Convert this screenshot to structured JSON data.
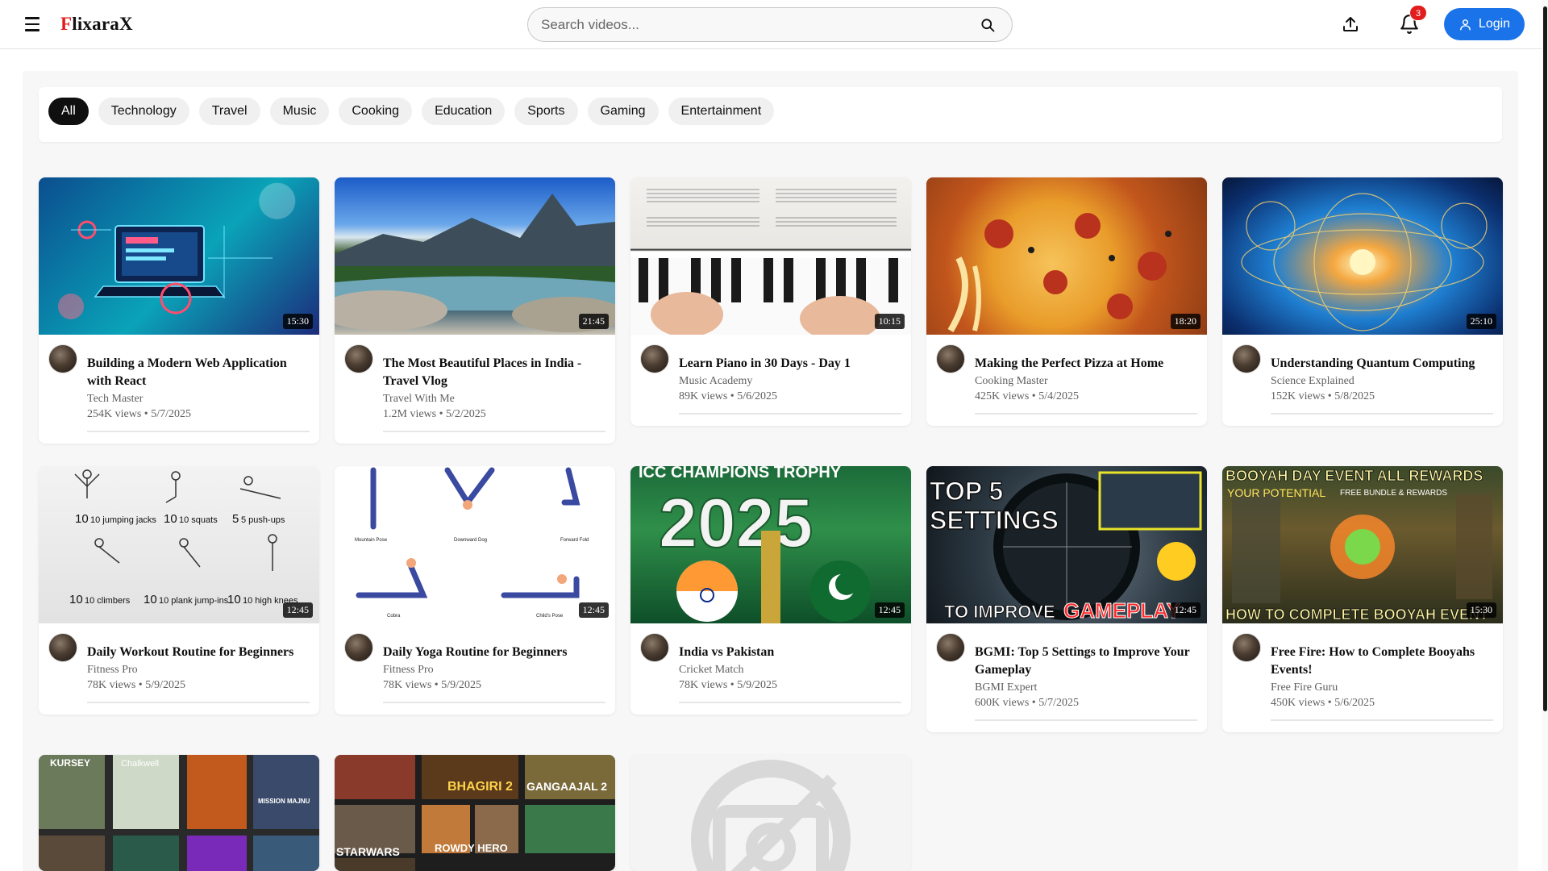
{
  "header": {
    "logo_first": "F",
    "logo_rest": "lixaraX",
    "search_placeholder": "Search videos...",
    "notification_count": "3",
    "login_label": "Login",
    "icons": {
      "menu": "hamburger-menu-icon",
      "search": "search-icon",
      "upload": "upload-icon",
      "bell": "bell-icon",
      "user": "user-icon"
    }
  },
  "categories": [
    {
      "label": "All",
      "active": true
    },
    {
      "label": "Technology",
      "active": false
    },
    {
      "label": "Travel",
      "active": false
    },
    {
      "label": "Music",
      "active": false
    },
    {
      "label": "Cooking",
      "active": false
    },
    {
      "label": "Education",
      "active": false
    },
    {
      "label": "Sports",
      "active": false
    },
    {
      "label": "Gaming",
      "active": false
    },
    {
      "label": "Entertainment",
      "active": false
    }
  ],
  "videos": [
    {
      "title": "Building a Modern Web Application with React",
      "channel": "Tech Master",
      "views": "254K views",
      "date": "5/7/2025",
      "duration": "15:30"
    },
    {
      "title": "The Most Beautiful Places in India - Travel Vlog",
      "channel": "Travel With Me",
      "views": "1.2M views",
      "date": "5/2/2025",
      "duration": "21:45"
    },
    {
      "title": "Learn Piano in 30 Days - Day 1",
      "channel": "Music Academy",
      "views": "89K views",
      "date": "5/6/2025",
      "duration": "10:15"
    },
    {
      "title": "Making the Perfect Pizza at Home",
      "channel": "Cooking Master",
      "views": "425K views",
      "date": "5/4/2025",
      "duration": "18:20"
    },
    {
      "title": "Understanding Quantum Computing",
      "channel": "Science Explained",
      "views": "152K views",
      "date": "5/8/2025",
      "duration": "25:10"
    },
    {
      "title": "Daily Workout Routine for Beginners",
      "channel": "Fitness Pro",
      "views": "78K views",
      "date": "5/9/2025",
      "duration": "12:45"
    },
    {
      "title": "Daily Yoga Routine for Beginners",
      "channel": "Fitness Pro",
      "views": "78K views",
      "date": "5/9/2025",
      "duration": "12:45"
    },
    {
      "title": "India vs Pakistan",
      "channel": "Cricket Match",
      "views": "78K views",
      "date": "5/9/2025",
      "duration": "12:45"
    },
    {
      "title": "BGMI: Top 5 Settings to Improve Your Gameplay",
      "channel": "BGMI Expert",
      "views": "600K views",
      "date": "5/7/2025",
      "duration": "12:45"
    },
    {
      "title": "Free Fire: How to Complete Booyahs Events!",
      "channel": "Free Fire Guru",
      "views": "450K views",
      "date": "5/6/2025",
      "duration": "15:30"
    }
  ],
  "thumb_text": {
    "workout": [
      "10 jumping jacks",
      "10 squats",
      "5 push-ups",
      "10 climbers",
      "10 plank jump-ins",
      "10 high knees"
    ],
    "yoga": [
      "Mountain Pose",
      "Downward Dog",
      "Forward Fold",
      "Cobra",
      "Child's Pose"
    ],
    "cricket": [
      "ICC CHAMPIONS TROPHY",
      "2025"
    ],
    "bgmi": [
      "TOP 5",
      "SETTINGS",
      "TO IMPROVE",
      "GAMEPLAY"
    ],
    "freefire": [
      "BOOYAH DAY EVENT ALL REWARDS",
      "YOUR POTENTIAL",
      "FREE BUNDLE & REWARDS",
      "HOW TO COMPLETE BOOYAH EVENT"
    ],
    "movies": [
      "KURSEY",
      "Chalkwell",
      "MISSION MAJNU"
    ],
    "movies2": [
      "BHAGIRI 2",
      "GANGAAJAL 2",
      "STARWARS",
      "ROWDY HERO"
    ]
  },
  "colors": {
    "brand_red": "#e11d1d",
    "login_blue": "#1a73e8",
    "chip_active": "#0f0f0f"
  }
}
